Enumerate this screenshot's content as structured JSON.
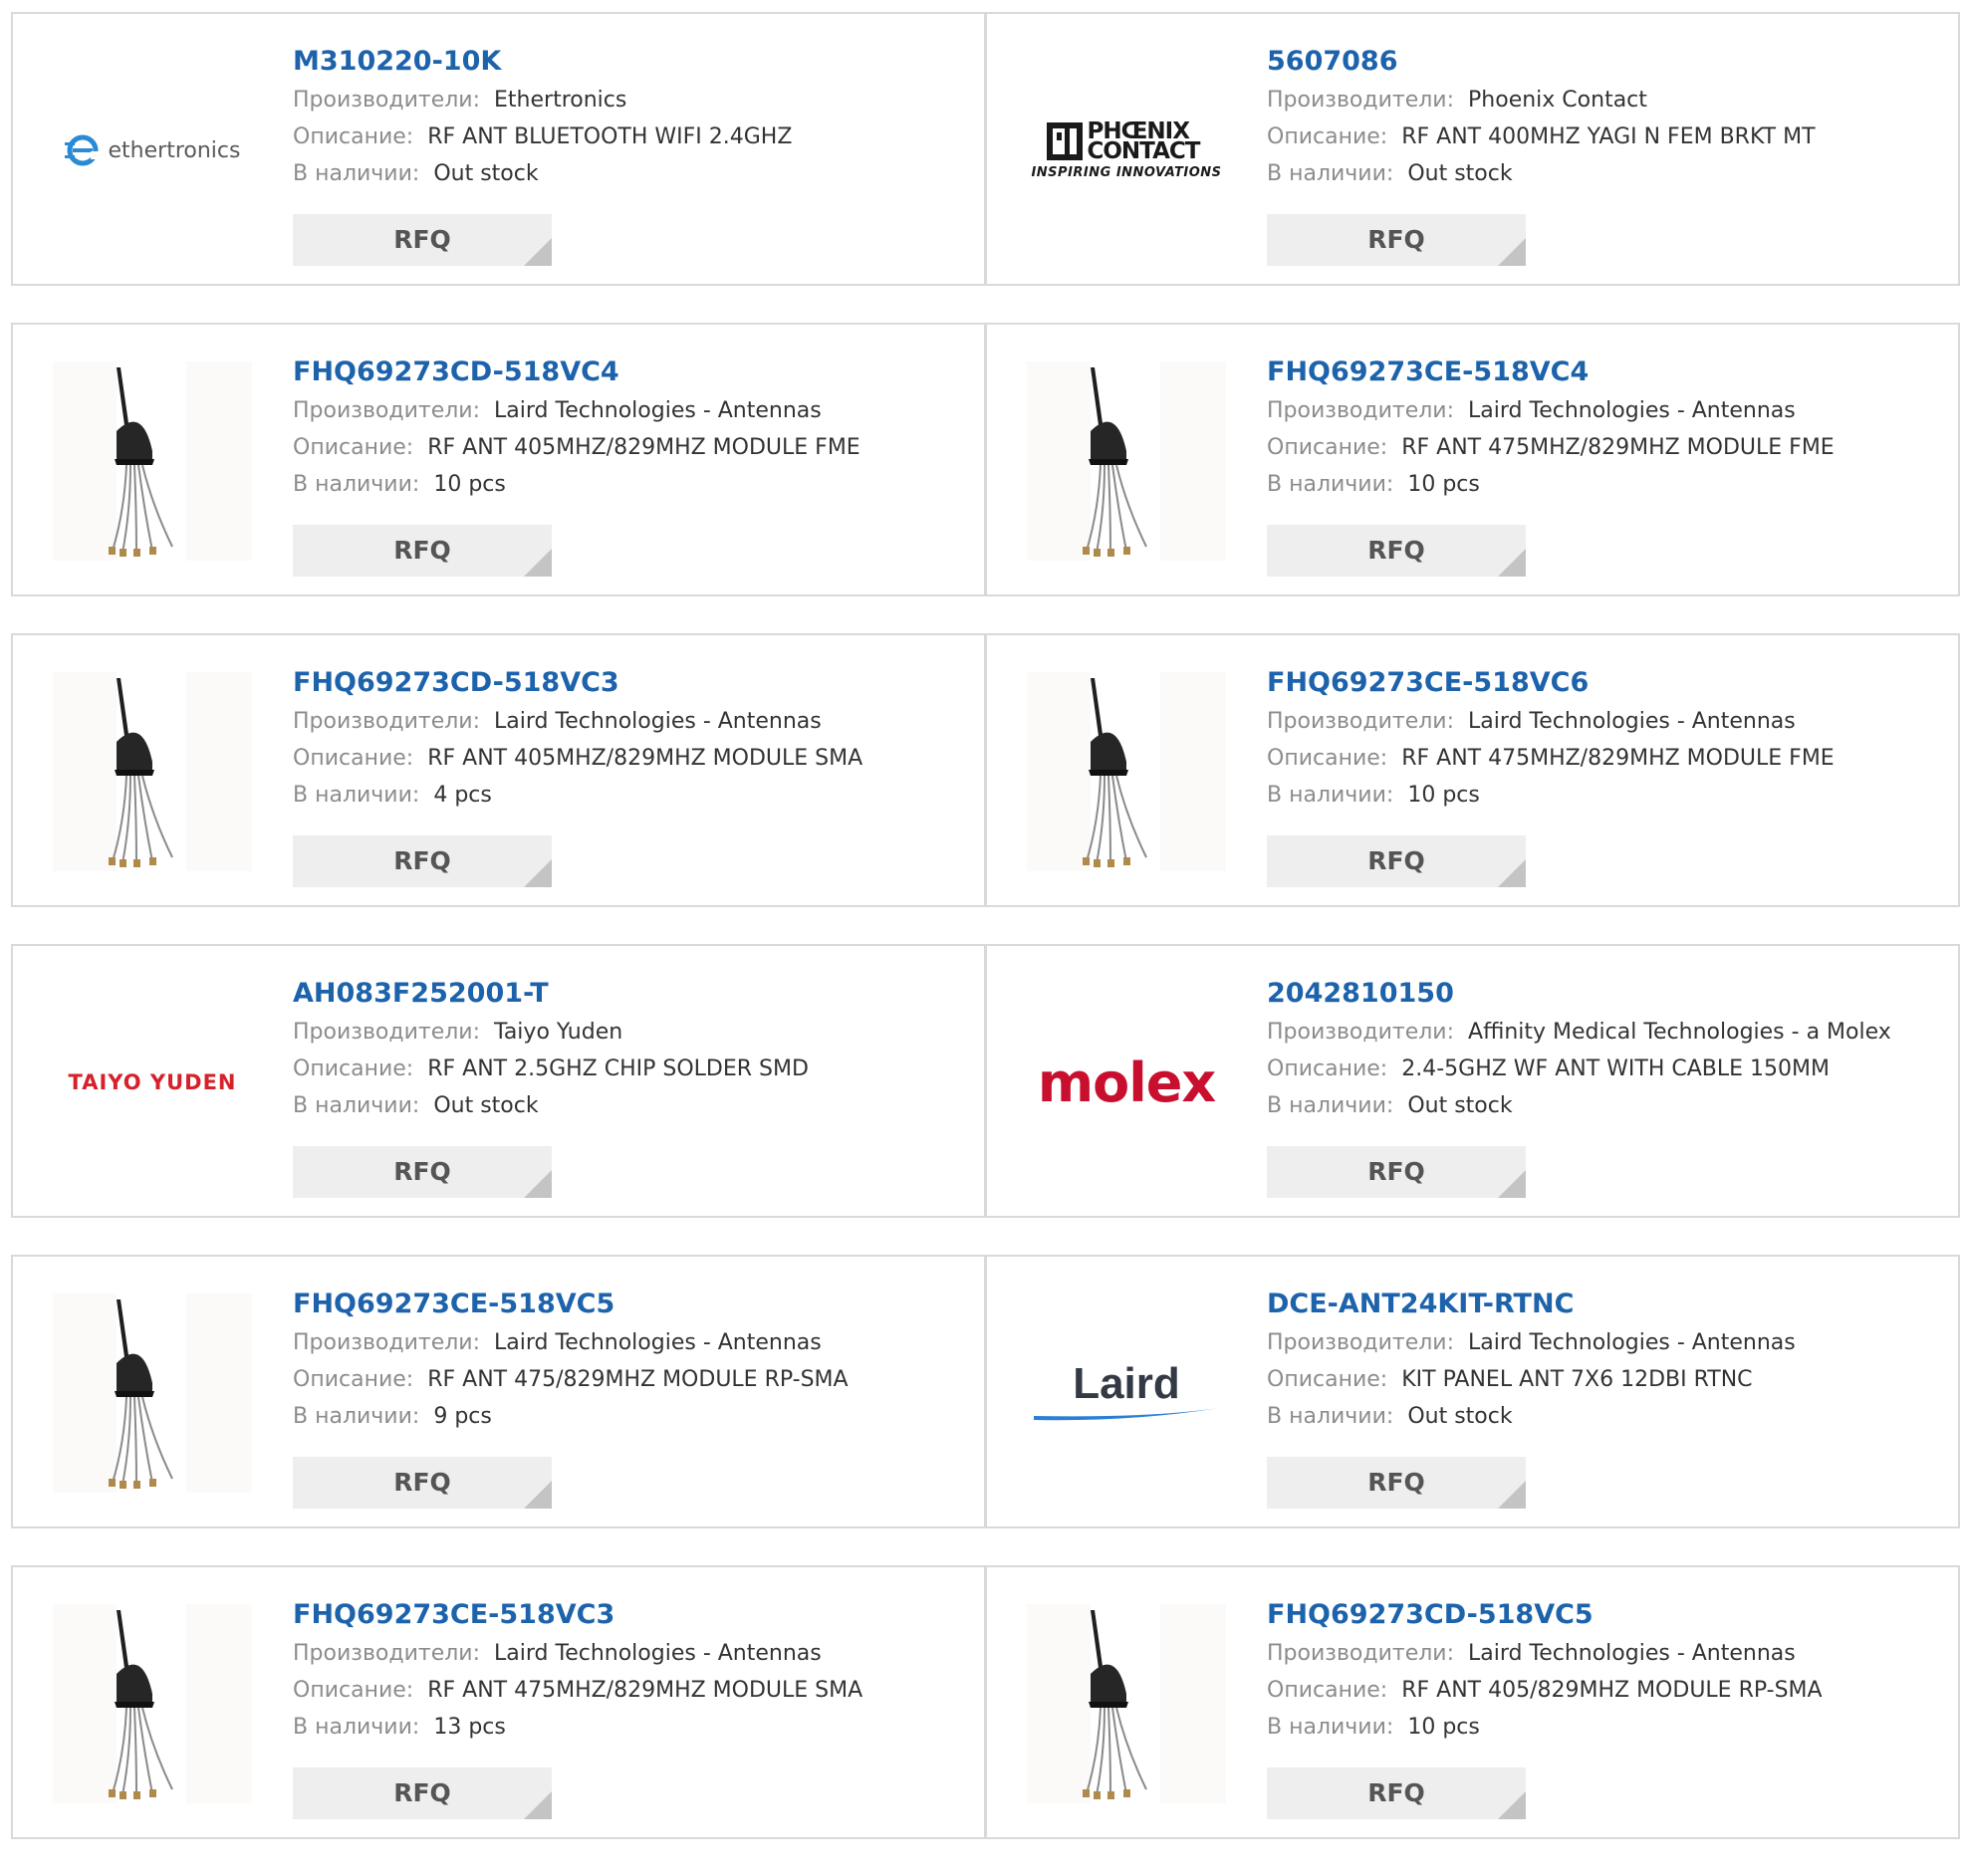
{
  "labels": {
    "manufacturer": "Производители:",
    "description": "Описание:",
    "stock": "В наличии:",
    "rfq": "RFQ"
  },
  "products": [
    {
      "part": "M310220-10K",
      "manufacturer": "Ethertronics",
      "description": "RF ANT BLUETOOTH WIFI 2.4GHZ",
      "stock": "Out stock",
      "logo": "ethertronics",
      "logo_text": "ethertronics"
    },
    {
      "part": "5607086",
      "manufacturer": "Phoenix Contact",
      "description": "RF ANT 400MHZ YAGI N FEM BRKT MT",
      "stock": "Out stock",
      "logo": "phoenix-contact",
      "logo_text": "PHŒNIX CONTACT",
      "logo_tagline": "INSPIRING INNOVATIONS"
    },
    {
      "part": "FHQ69273CD-518VC4",
      "manufacturer": "Laird Technologies - Antennas",
      "description": "RF ANT 405MHZ/829MHZ MODULE FME",
      "stock": "10 pcs",
      "logo": "antenna-photo"
    },
    {
      "part": "FHQ69273CE-518VC4",
      "manufacturer": "Laird Technologies - Antennas",
      "description": "RF ANT 475MHZ/829MHZ MODULE FME",
      "stock": "10 pcs",
      "logo": "antenna-photo"
    },
    {
      "part": "FHQ69273CD-518VC3",
      "manufacturer": "Laird Technologies - Antennas",
      "description": "RF ANT 405MHZ/829MHZ MODULE SMA",
      "stock": "4 pcs",
      "logo": "antenna-photo"
    },
    {
      "part": "FHQ69273CE-518VC6",
      "manufacturer": "Laird Technologies - Antennas",
      "description": "RF ANT 475MHZ/829MHZ MODULE FME",
      "stock": "10 pcs",
      "logo": "antenna-photo"
    },
    {
      "part": "AH083F252001-T",
      "manufacturer": "Taiyo Yuden",
      "description": "RF ANT 2.5GHZ CHIP SOLDER SMD",
      "stock": "Out stock",
      "logo": "taiyo-yuden",
      "logo_text": "TAIYO YUDEN"
    },
    {
      "part": "2042810150",
      "manufacturer": "Affinity Medical Technologies - a Molex",
      "description": "2.4-5GHZ WF ANT WITH CABLE 150MM",
      "stock": "Out stock",
      "logo": "molex",
      "logo_text": "molex"
    },
    {
      "part": "FHQ69273CE-518VC5",
      "manufacturer": "Laird Technologies - Antennas",
      "description": "RF ANT 475/829MHZ MODULE RP-SMA",
      "stock": "9 pcs",
      "logo": "antenna-photo"
    },
    {
      "part": "DCE-ANT24KIT-RTNC",
      "manufacturer": "Laird Technologies - Antennas",
      "description": "KIT PANEL ANT 7X6 12DBI RTNC",
      "stock": "Out stock",
      "logo": "laird",
      "logo_text": "Laird"
    },
    {
      "part": "FHQ69273CE-518VC3",
      "manufacturer": "Laird Technologies - Antennas",
      "description": "RF ANT 475MHZ/829MHZ MODULE SMA",
      "stock": "13 pcs",
      "logo": "antenna-photo"
    },
    {
      "part": "FHQ69273CD-518VC5",
      "manufacturer": "Laird Technologies - Antennas",
      "description": "RF ANT 405/829MHZ MODULE RP-SMA",
      "stock": "10 pcs",
      "logo": "antenna-photo"
    }
  ],
  "colors": {
    "link": "#1d63ab",
    "label": "#8c8c8c",
    "value": "#333333",
    "border": "#d9d9d9",
    "button_bg": "#eeeeee",
    "button_text": "#555555",
    "taiyo_red": "#d6202a",
    "molex_red": "#c8102e",
    "laird_blue": "#2a7fd4"
  }
}
